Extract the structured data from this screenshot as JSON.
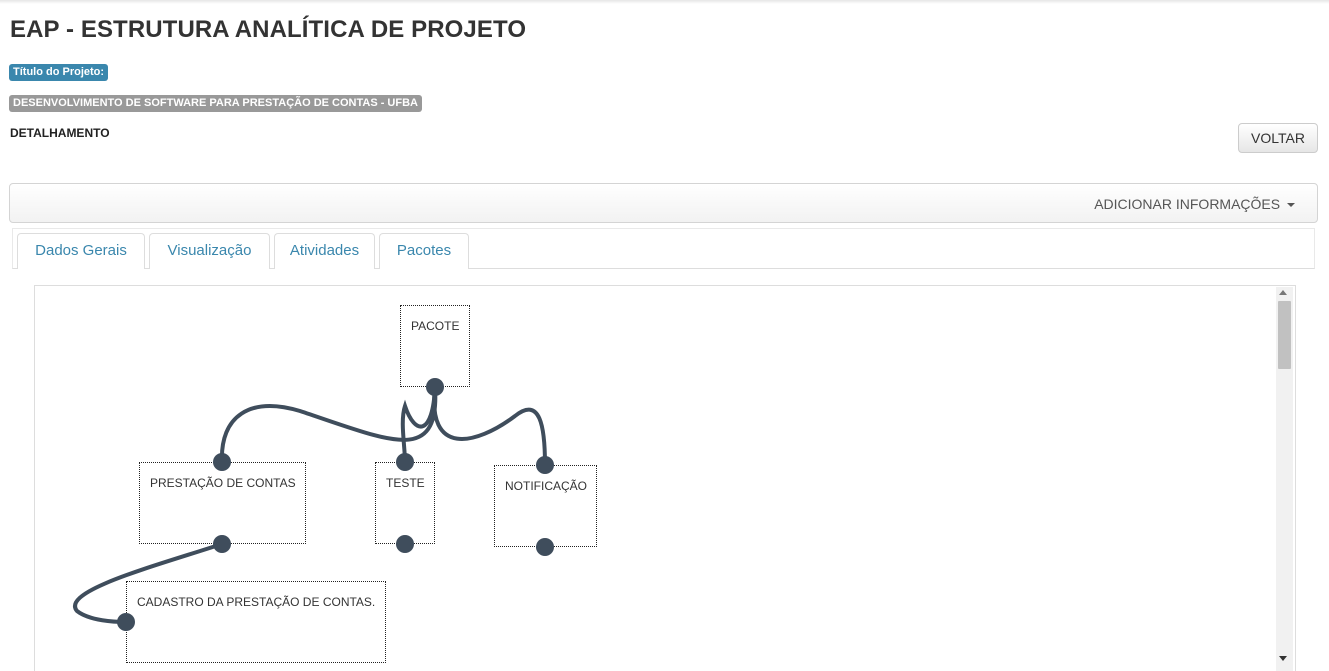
{
  "page": {
    "title": "EAP - ESTRUTURA ANALÍTICA DE PROJETO",
    "project_title_label": "Título do Projeto:",
    "project_name": "DESENVOLVIMENTO DE SOFTWARE PARA PRESTAÇÃO DE CONTAS - UFBA",
    "section_heading": "DETALHAMENTO",
    "back_button": "VOLTAR"
  },
  "navbar": {
    "dropdown_label": "ADICIONAR INFORMAÇÕES"
  },
  "tabs": [
    {
      "label": "Dados Gerais"
    },
    {
      "label": "Visualização"
    },
    {
      "label": "Atividades"
    },
    {
      "label": "Pacotes"
    }
  ],
  "diagram": {
    "connector_color": "#3f4d5c",
    "nodes": {
      "pacote": "PACOTE",
      "prestacao": "PRESTAÇÃO DE CONTAS",
      "teste": "TESTE",
      "notificacao": "NOTIFICAÇÃO",
      "cadastro": "CADASTRO DA PRESTAÇÃO DE CONTAS."
    },
    "edges": [
      {
        "from": "PACOTE",
        "to": "PRESTAÇÃO DE CONTAS"
      },
      {
        "from": "PACOTE",
        "to": "TESTE"
      },
      {
        "from": "PACOTE",
        "to": "NOTIFICAÇÃO"
      },
      {
        "from": "PRESTAÇÃO DE CONTAS",
        "to": "CADASTRO DA PRESTAÇÃO DE CONTAS."
      }
    ]
  },
  "colors": {
    "info_badge": "#3a87ad",
    "default_badge": "#999999",
    "tab_link": "#3a87ad"
  }
}
